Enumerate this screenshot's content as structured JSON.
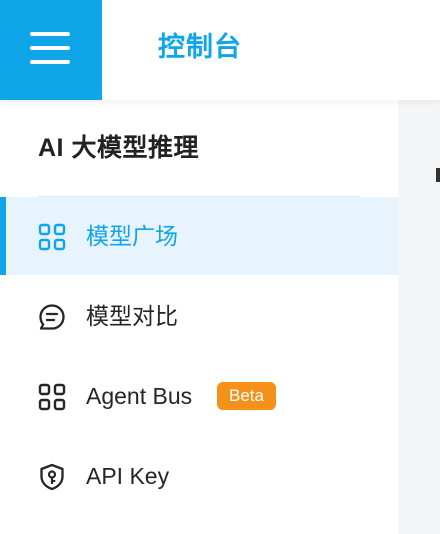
{
  "header": {
    "menu_icon": "hamburger-menu-icon",
    "title": "控制台",
    "accent_color": "#0ea5e9"
  },
  "sidebar": {
    "section_title": "AI 大模型推理",
    "items": [
      {
        "label": "模型广场",
        "icon": "grid-icon",
        "active": true
      },
      {
        "label": "模型对比",
        "icon": "chat-compare-icon",
        "active": false
      },
      {
        "label": "Agent Bus",
        "icon": "grid-icon",
        "active": false,
        "badge": "Beta",
        "badge_color": "#f59019"
      },
      {
        "label": "API Key",
        "icon": "shield-key-icon",
        "active": false
      }
    ]
  }
}
